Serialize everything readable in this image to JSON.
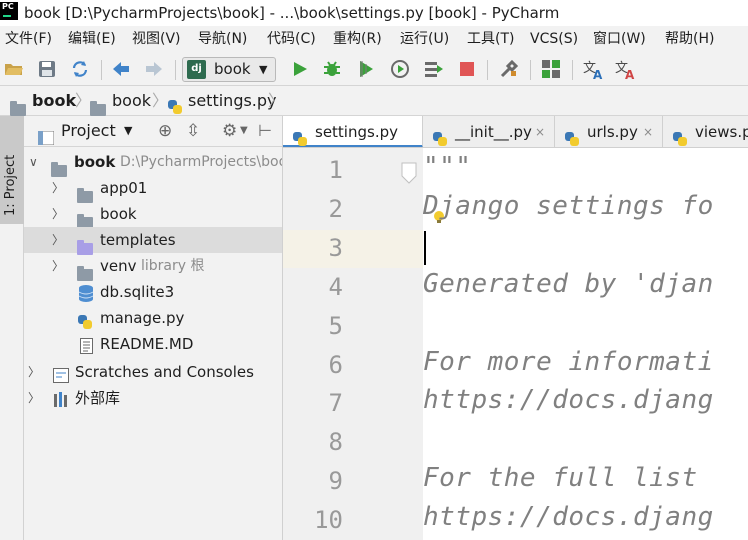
{
  "window": {
    "logo_text": "PC",
    "title": "book [D:\\PycharmProjects\\book] - ...\\book\\settings.py [book] - PyCharm"
  },
  "menu": [
    "文件(F)",
    "编辑(E)",
    "视图(V)",
    "导航(N)",
    "代码(C)",
    "重构(R)",
    "运行(U)",
    "工具(T)",
    "VCS(S)",
    "窗口(W)",
    "帮助(H)"
  ],
  "toolbar": {
    "run_config": "book",
    "run_config_badge": "dj"
  },
  "breadcrumb": [
    "book",
    "book",
    "settings.py"
  ],
  "side_strip": {
    "project_tab": "1: Project"
  },
  "project_panel": {
    "header": "Project",
    "tree": [
      {
        "label": "book",
        "extra": "D:\\PycharmProjects\\book"
      },
      {
        "label": "app01"
      },
      {
        "label": "book"
      },
      {
        "label": "templates"
      },
      {
        "label": "venv",
        "extra": "library 根"
      },
      {
        "label": "db.sqlite3"
      },
      {
        "label": "manage.py"
      },
      {
        "label": "README.MD"
      },
      {
        "label": "Scratches and Consoles"
      },
      {
        "label": "外部库"
      }
    ]
  },
  "tabs": [
    {
      "label": "settings.py",
      "close": "×"
    },
    {
      "label": "__init__.py",
      "close": "×"
    },
    {
      "label": "urls.py",
      "close": "×"
    },
    {
      "label": "views.py"
    }
  ],
  "editor": {
    "line_numbers": [
      "1",
      "2",
      "3",
      "4",
      "5",
      "6",
      "7",
      "8",
      "9",
      "10"
    ],
    "lines": [
      "\"\"\"",
      "Django settings fo",
      "",
      "Generated by 'djan",
      "",
      "For more informati",
      "https://docs.djang",
      "",
      "For the full list",
      "https://docs.djang"
    ]
  },
  "colors": {
    "accent": "#4083c9",
    "run_green": "#3ba23b",
    "stop_red": "#e05555"
  }
}
